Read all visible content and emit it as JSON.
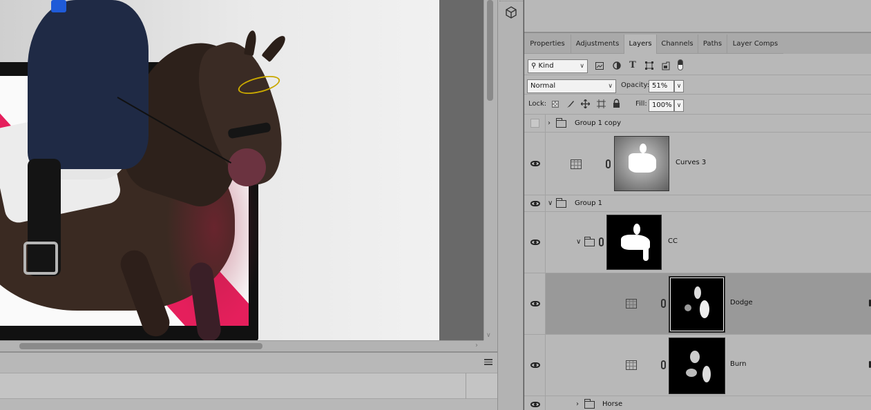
{
  "canvas": {
    "background_color": "#b3b3b3"
  },
  "dock": {
    "icon": "3d-cube-icon"
  },
  "panel": {
    "tabs": [
      {
        "label": "Properties",
        "active": false
      },
      {
        "label": "Adjustments",
        "active": false
      },
      {
        "label": "Layers",
        "active": true
      },
      {
        "label": "Channels",
        "active": false
      },
      {
        "label": "Paths",
        "active": false
      },
      {
        "label": "Layer Comps",
        "active": false
      }
    ],
    "filter": {
      "kind_label": "Kind",
      "icons": [
        "pixel-filter-icon",
        "adjustment-filter-icon",
        "type-filter-icon",
        "shape-filter-icon",
        "smart-object-filter-icon",
        "filter-toggle-icon"
      ]
    },
    "blend": {
      "mode": "Normal",
      "opacity_label": "Opacity:",
      "opacity_value": "51%"
    },
    "lock": {
      "lock_label": "Lock:",
      "icons": [
        "lock-transparent-icon",
        "lock-pixels-icon",
        "lock-position-icon",
        "lock-artboard-icon",
        "lock-all-icon"
      ],
      "fill_label": "Fill:",
      "fill_value": "100%"
    },
    "layers": [
      {
        "name": "Group 1 copy",
        "type": "group",
        "visible": false,
        "expanded": false
      },
      {
        "name": "Curves 3",
        "type": "adjustment",
        "visible": true
      },
      {
        "name": "Group 1",
        "type": "group",
        "visible": true,
        "expanded": true
      },
      {
        "name": "CC",
        "type": "group",
        "visible": true,
        "expanded": true
      },
      {
        "name": "Dodge",
        "type": "adjustment",
        "visible": true,
        "selected": true
      },
      {
        "name": "Burn",
        "type": "adjustment",
        "visible": true
      },
      {
        "name": "Horse",
        "type": "group",
        "visible": true,
        "expanded": false
      }
    ]
  },
  "colors": {
    "accent_pink": "#e51f5c",
    "panel_bg": "#b8b8b8",
    "selected_row": "#999999"
  }
}
